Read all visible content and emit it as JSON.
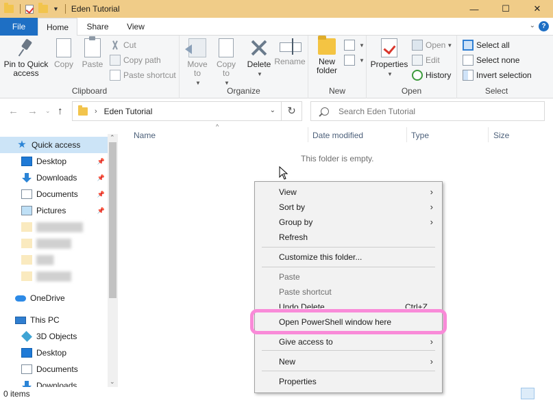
{
  "window": {
    "title": "Eden Tutorial",
    "controls": {
      "minimize": "—",
      "maximize": "☐",
      "close": "✕"
    }
  },
  "ribbon_tabs": [
    "File",
    "Home",
    "Share",
    "View"
  ],
  "ribbon": {
    "clipboard": {
      "label": "Clipboard",
      "pin": "Pin to Quick access",
      "copy": "Copy",
      "paste": "Paste",
      "cut": "Cut",
      "copy_path": "Copy path",
      "paste_shortcut": "Paste shortcut"
    },
    "organize": {
      "label": "Organize",
      "move_to": "Move to",
      "copy_to": "Copy to",
      "delete": "Delete",
      "rename": "Rename"
    },
    "new": {
      "label": "New",
      "new_folder": "New folder"
    },
    "open": {
      "label": "Open",
      "properties": "Properties",
      "open": "Open",
      "edit": "Edit",
      "history": "History"
    },
    "select": {
      "label": "Select",
      "select_all": "Select all",
      "select_none": "Select none",
      "invert_selection": "Invert selection"
    }
  },
  "address": {
    "path": "Eden Tutorial",
    "search_placeholder": "Search Eden Tutorial"
  },
  "nav": {
    "quick_access": "Quick access",
    "items": [
      {
        "label": "Desktop",
        "pinned": true
      },
      {
        "label": "Downloads",
        "pinned": true
      },
      {
        "label": "Documents",
        "pinned": true
      },
      {
        "label": "Pictures",
        "pinned": true
      }
    ],
    "onedrive": "OneDrive",
    "this_pc": "This PC",
    "pc_items": [
      "3D Objects",
      "Desktop",
      "Documents",
      "Downloads"
    ]
  },
  "columns": [
    "Name",
    "Date modified",
    "Type",
    "Size"
  ],
  "content": {
    "empty_message": "This folder is empty."
  },
  "status": {
    "items": "0 items"
  },
  "context_menu": {
    "view": "View",
    "sort_by": "Sort by",
    "group_by": "Group by",
    "refresh": "Refresh",
    "customize": "Customize this folder...",
    "paste": "Paste",
    "paste_shortcut": "Paste shortcut",
    "undo_delete": "Undo Delete",
    "undo_shortcut": "Ctrl+Z",
    "powershell": "Open PowerShell window here",
    "give_access": "Give access to",
    "new": "New",
    "properties": "Properties"
  },
  "colors": {
    "titlebar": "#f0cc88",
    "file_tab": "#1e6fc4",
    "highlight_ring": "#f98ad8",
    "selected_nav": "#cce4f7"
  }
}
